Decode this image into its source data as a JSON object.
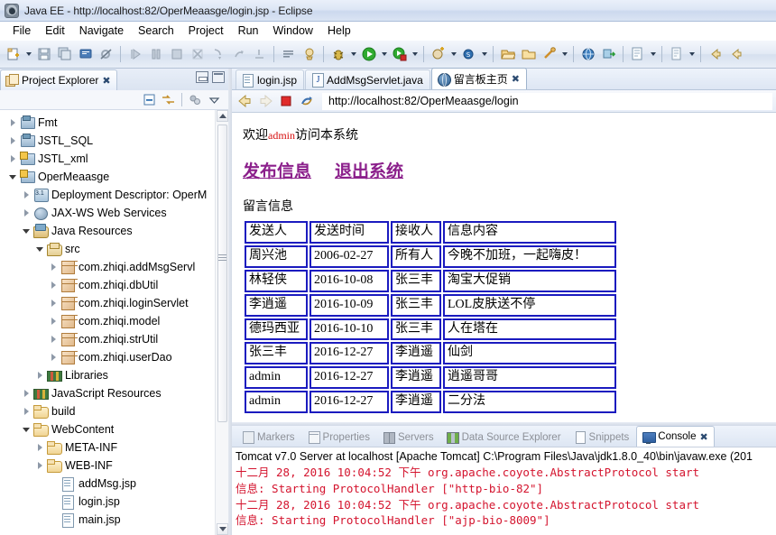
{
  "window": {
    "title": "Java EE - http://localhost:82/OperMeaasge/login.jsp - Eclipse",
    "app_icon": "eclipse-icon"
  },
  "menubar": {
    "items": [
      "File",
      "Edit",
      "Navigate",
      "Search",
      "Project",
      "Run",
      "Window",
      "Help"
    ]
  },
  "toolbar": {
    "groups": [
      {
        "buttons": [
          {
            "name": "new-wizard-button",
            "icon": "new-file-icon",
            "dropdown": true
          },
          {
            "name": "save-button",
            "icon": "save-icon",
            "dropdown": false
          },
          {
            "name": "save-all-button",
            "icon": "save-all-icon",
            "dropdown": false
          },
          {
            "name": "print-button",
            "icon": "console-view-icon",
            "dropdown": false
          },
          {
            "name": "toggle-breakpoint-button",
            "icon": "skip-breakpoints-icon",
            "dropdown": false
          }
        ]
      },
      {
        "buttons": [
          {
            "name": "resume-button",
            "icon": "resume-icon",
            "dropdown": false
          },
          {
            "name": "suspend-button",
            "icon": "suspend-icon",
            "dropdown": false
          },
          {
            "name": "terminate-button",
            "icon": "terminate-icon",
            "dropdown": false
          },
          {
            "name": "disconnect-button",
            "icon": "disconnect-icon",
            "dropdown": false
          },
          {
            "name": "step-into-button",
            "icon": "step-into-icon",
            "dropdown": false
          },
          {
            "name": "step-over-button",
            "icon": "step-over-icon",
            "dropdown": false
          },
          {
            "name": "step-return-button",
            "icon": "step-return-icon",
            "dropdown": false
          }
        ]
      },
      {
        "buttons": [
          {
            "name": "open-task-button",
            "icon": "task-list-icon",
            "dropdown": false
          },
          {
            "name": "open-type-button",
            "icon": "open-type-icon",
            "dropdown": false
          }
        ]
      },
      {
        "buttons": [
          {
            "name": "debug-button",
            "icon": "debug-bug-icon",
            "dropdown": true
          },
          {
            "name": "run-button",
            "icon": "run-green-icon",
            "dropdown": true
          },
          {
            "name": "run-external-tools-button",
            "icon": "external-tools-icon",
            "dropdown": true
          }
        ]
      },
      {
        "buttons": [
          {
            "name": "new-java-class-button",
            "icon": "new-class-icon",
            "dropdown": true
          },
          {
            "name": "new-annotation-button",
            "icon": "new-annotation-icon",
            "dropdown": true
          }
        ]
      },
      {
        "buttons": [
          {
            "name": "open-resource-button",
            "icon": "open-folder-icon",
            "dropdown": false
          },
          {
            "name": "open-perspective-button",
            "icon": "open-perspective-icon",
            "dropdown": false
          },
          {
            "name": "link-editor-button",
            "icon": "link-wrench-icon",
            "dropdown": true
          }
        ]
      },
      {
        "buttons": [
          {
            "name": "web-browser-button",
            "icon": "globe-icon",
            "dropdown": false
          },
          {
            "name": "deploy-button",
            "icon": "deploy-icon",
            "dropdown": false
          }
        ]
      },
      {
        "buttons": [
          {
            "name": "new-jsp-button",
            "icon": "new-jsp-icon",
            "dropdown": true
          }
        ]
      },
      {
        "buttons": [
          {
            "name": "new-xml-button",
            "icon": "new-xml-icon",
            "dropdown": true
          }
        ]
      },
      {
        "buttons": [
          {
            "name": "back-button",
            "icon": "arrow-left-icon",
            "dropdown": false
          },
          {
            "name": "forward-button",
            "icon": "arrow-left-alt-icon",
            "dropdown": false
          }
        ]
      }
    ]
  },
  "project_explorer": {
    "tab_label": "Project Explorer",
    "close_glyph": "✖",
    "toolbar": [
      {
        "name": "collapse-all-button",
        "icon": "collapse-all-icon"
      },
      {
        "name": "link-with-editor-button",
        "icon": "link-editor-icon"
      },
      {
        "name": "view-menu-focus-button",
        "icon": "focus-icon"
      },
      {
        "name": "view-menu-button",
        "icon": "chevron-down-icon"
      }
    ],
    "tree": [
      {
        "label": "Fmt",
        "indent": 0,
        "twist": "closed",
        "icon": "ic-proj",
        "lock": false
      },
      {
        "label": "JSTL_SQL",
        "indent": 0,
        "twist": "closed",
        "icon": "ic-proj",
        "lock": false
      },
      {
        "label": "JSTL_xml",
        "indent": 0,
        "twist": "closed",
        "icon": "ic-proj",
        "lock": true
      },
      {
        "label": "OperMeaasge",
        "indent": 0,
        "twist": "open",
        "icon": "ic-proj",
        "lock": true
      },
      {
        "label": "Deployment Descriptor: OperM",
        "indent": 1,
        "twist": "closed",
        "icon": "ic-dd",
        "lock": false
      },
      {
        "label": "JAX-WS Web Services",
        "indent": 1,
        "twist": "closed",
        "icon": "ic-ws",
        "lock": false
      },
      {
        "label": "Java Resources",
        "indent": 1,
        "twist": "open",
        "icon": "ic-jr",
        "lock": false
      },
      {
        "label": "src",
        "indent": 2,
        "twist": "open",
        "icon": "ic-src",
        "lock": false
      },
      {
        "label": "com.zhiqi.addMsgServl",
        "indent": 3,
        "twist": "closed",
        "icon": "ic-pkg",
        "lock": false
      },
      {
        "label": "com.zhiqi.dbUtil",
        "indent": 3,
        "twist": "closed",
        "icon": "ic-pkg",
        "lock": false
      },
      {
        "label": "com.zhiqi.loginServlet",
        "indent": 3,
        "twist": "closed",
        "icon": "ic-pkg",
        "lock": false
      },
      {
        "label": "com.zhiqi.model",
        "indent": 3,
        "twist": "closed",
        "icon": "ic-pkg",
        "lock": false
      },
      {
        "label": "com.zhiqi.strUtil",
        "indent": 3,
        "twist": "closed",
        "icon": "ic-pkg",
        "lock": false
      },
      {
        "label": "com.zhiqi.userDao",
        "indent": 3,
        "twist": "closed",
        "icon": "ic-pkg",
        "lock": false
      },
      {
        "label": "Libraries",
        "indent": 2,
        "twist": "closed",
        "icon": "ic-lib",
        "lock": false
      },
      {
        "label": "JavaScript Resources",
        "indent": 1,
        "twist": "closed",
        "icon": "ic-js",
        "lock": false
      },
      {
        "label": "build",
        "indent": 1,
        "twist": "closed",
        "icon": "ic-fold",
        "lock": false
      },
      {
        "label": "WebContent",
        "indent": 1,
        "twist": "open",
        "icon": "ic-fold",
        "lock": false
      },
      {
        "label": "META-INF",
        "indent": 2,
        "twist": "closed",
        "icon": "ic-fold",
        "lock": false
      },
      {
        "label": "WEB-INF",
        "indent": 2,
        "twist": "closed",
        "icon": "ic-fold",
        "lock": true
      },
      {
        "label": "addMsg.jsp",
        "indent": 3,
        "twist": "none",
        "icon": "ic-file",
        "lock": false
      },
      {
        "label": "login.jsp",
        "indent": 3,
        "twist": "none",
        "icon": "ic-file",
        "lock": false
      },
      {
        "label": "main.jsp",
        "indent": 3,
        "twist": "none",
        "icon": "ic-file",
        "lock": false
      }
    ]
  },
  "editor": {
    "tabs": [
      {
        "label": "login.jsp",
        "icon": "jsp-file-icon",
        "active": false,
        "closable": false
      },
      {
        "label": "AddMsgServlet.java",
        "icon": "java-file-icon",
        "active": false,
        "closable": false
      },
      {
        "label": "留言板主页",
        "icon": "web-browser-icon",
        "active": true,
        "closable": true
      }
    ],
    "close_glyph": "✖"
  },
  "browser": {
    "buttons": [
      {
        "name": "browser-back-button",
        "icon": "arrow-left-icon"
      },
      {
        "name": "browser-forward-button",
        "icon": "arrow-right-icon"
      },
      {
        "name": "browser-stop-button",
        "icon": "stop-square-icon"
      },
      {
        "name": "browser-refresh-button",
        "icon": "refresh-icon"
      }
    ],
    "url": "http://localhost:82/OperMeaasge/login",
    "url_placeholder": "http://"
  },
  "page": {
    "welcome_prefix": "欢迎",
    "welcome_user": "admin",
    "welcome_suffix": "访问本系统",
    "links": [
      {
        "label": "发布信息",
        "name": "publish-message-link"
      },
      {
        "label": "退出系统",
        "name": "logout-link"
      }
    ],
    "section_title": "留言信息",
    "table": {
      "border_color": "#1b1bbf",
      "headers": [
        "发送人",
        "发送时间",
        "接收人",
        "信息内容"
      ],
      "rows": [
        [
          "周兴池",
          "2006-02-27",
          "所有人",
          "今晚不加班，一起嗨皮！"
        ],
        [
          "林轻侠",
          "2016-10-08",
          "张三丰",
          "淘宝大促销"
        ],
        [
          "李逍遥",
          "2016-10-09",
          "张三丰",
          "LOL皮肤送不停"
        ],
        [
          "德玛西亚",
          "2016-10-10",
          "张三丰",
          "人在塔在"
        ],
        [
          "张三丰",
          "2016-12-27",
          "李逍遥",
          "仙剑"
        ],
        [
          "admin",
          "2016-12-27",
          "李逍遥",
          "逍遥哥哥"
        ],
        [
          "admin",
          "2016-12-27",
          "李逍遥",
          "二分法"
        ]
      ]
    }
  },
  "bottom_panel": {
    "tabs": [
      {
        "label": "Markers",
        "icon": "markers-icon",
        "active": false,
        "closable": false
      },
      {
        "label": "Properties",
        "icon": "properties-icon",
        "active": false,
        "closable": false
      },
      {
        "label": "Servers",
        "icon": "servers-icon",
        "active": false,
        "closable": false
      },
      {
        "label": "Data Source Explorer",
        "icon": "datasource-icon",
        "active": false,
        "closable": false
      },
      {
        "label": "Snippets",
        "icon": "snippets-icon",
        "active": false,
        "closable": false
      },
      {
        "label": "Console",
        "icon": "console-icon",
        "active": true,
        "closable": true
      }
    ],
    "close_glyph": "✖",
    "console_header": "Tomcat v7.0 Server at localhost [Apache Tomcat] C:\\Program Files\\Java\\jdk1.8.0_40\\bin\\javaw.exe (201",
    "console_lines": [
      "十二月 28, 2016 10:04:52 下午 org.apache.coyote.AbstractProtocol start",
      "信息: Starting ProtocolHandler [\"http-bio-82\"]",
      "十二月 28, 2016 10:04:52 下午 org.apache.coyote.AbstractProtocol start",
      "信息: Starting ProtocolHandler [\"ajp-bio-8009\"]"
    ],
    "console_text_color": "#d4142e"
  }
}
